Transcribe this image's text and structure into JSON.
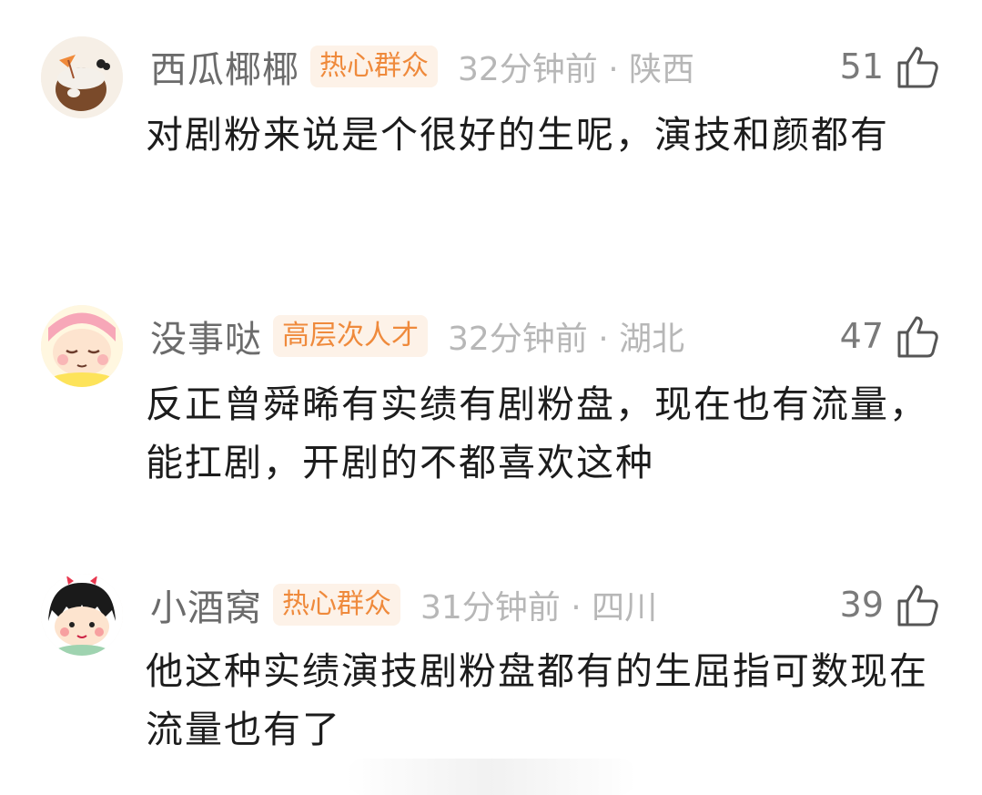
{
  "comments": [
    {
      "username": "西瓜椰椰",
      "badge": "热心群众",
      "meta": "32分钟前 · 陕西",
      "likes": "51",
      "text": "对剧粉来说是个很好的生呢，演技和颜都有",
      "avatar_icon": "coconut-drink-avatar"
    },
    {
      "username": "没事哒",
      "badge": "高层次人才",
      "meta": "32分钟前 · 湖北",
      "likes": "47",
      "text": "反正曾舜晞有实绩有剧粉盘，现在也有流量，能扛剧，开剧的不都喜欢这种",
      "avatar_icon": "sleepy-girl-avatar"
    },
    {
      "username": "小酒窝",
      "badge": "热心群众",
      "meta": "31分钟前 · 四川",
      "likes": "39",
      "text": "他这种实绩演技剧粉盘都有的生屈指可数现在流量也有了",
      "avatar_icon": "maruko-avatar"
    }
  ],
  "colors": {
    "badge_bg": "#fdf2e8",
    "badge_text": "#ef8a3c",
    "username": "#6b6b6b",
    "meta": "#b7b7b7",
    "body": "#1c1c1c"
  }
}
